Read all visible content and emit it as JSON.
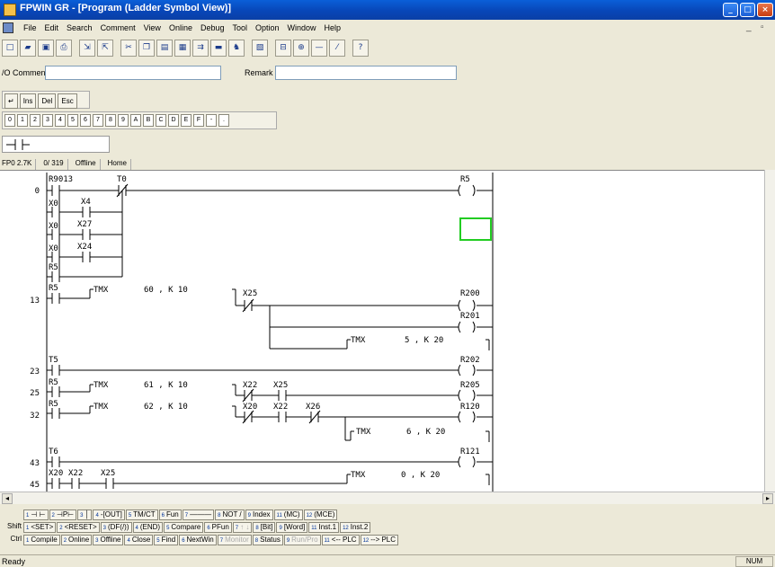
{
  "window": {
    "title": "FPWIN GR - [Program (Ladder Symbol View)]"
  },
  "menu": {
    "items": [
      "File",
      "Edit",
      "Search",
      "Comment",
      "View",
      "Online",
      "Debug",
      "Tool",
      "Option",
      "Window",
      "Help"
    ]
  },
  "io": {
    "comment_label": "/O Comment",
    "remark_label": "Remark"
  },
  "edit_buttons": [
    "↵",
    "Ins",
    "Del",
    "Esc"
  ],
  "hexkeys": [
    "0",
    "1",
    "2",
    "3",
    "4",
    "5",
    "6",
    "7",
    "8",
    "9",
    "A",
    "B",
    "C",
    "D",
    "E",
    "F",
    "-",
    "."
  ],
  "info": {
    "plc": "FP0 2.7K",
    "steps": "0/ 319",
    "mode": "Offline",
    "pos": "Home"
  },
  "ladder": {
    "r0": {
      "addr": "0",
      "c1": "R9013",
      "c2": "T0",
      "out": "R5",
      "p1": "X0",
      "p1b": "X4",
      "p2": "X0",
      "p2b": "X27",
      "p3": "X0",
      "p3b": "X24",
      "p4": "R5"
    },
    "r13": {
      "addr": "13",
      "c1": "R5",
      "fn": "TMX",
      "fn_args": "60 ,   K   10",
      "c2": "X25",
      "out1": "R200",
      "out2": "R201",
      "fn2": "TMX",
      "fn2_args": "5 ,   K   20"
    },
    "r23": {
      "addr": "23",
      "c1": "T5",
      "out": "R202"
    },
    "r25": {
      "addr": "25",
      "c1": "R5",
      "fn": "TMX",
      "fn_args": "61 ,   K   10",
      "c2": "X22",
      "c3": "X25",
      "out": "R205"
    },
    "r32": {
      "addr": "32",
      "c1": "R5",
      "fn": "TMX",
      "fn_args": "62 ,   K   10",
      "c2": "X20",
      "c3": "X22",
      "c4": "X26",
      "out": "R120",
      "fn2": "TMX",
      "fn2_args": "6 ,   K   20"
    },
    "r43": {
      "addr": "43",
      "c1": "T6",
      "out": "R121"
    },
    "r45": {
      "addr": "45",
      "c1": "X20",
      "c2": "X22",
      "c3": "X25",
      "fn": "TMX",
      "fn_args": "0 ,   K   20"
    }
  },
  "fkeys": {
    "row1": [
      [
        "1",
        "⊣ ⊢"
      ],
      [
        "2",
        "⊣P⊢"
      ],
      [
        "3",
        "│"
      ],
      [
        "4",
        "-[OUT]"
      ],
      [
        "5",
        "TM/CT"
      ],
      [
        "6",
        "Fun"
      ],
      [
        "7",
        "———"
      ],
      [
        "8",
        "NOT /"
      ],
      [
        "9",
        "Index"
      ],
      [
        "11",
        "(MC)"
      ],
      [
        "12",
        "(MCE)"
      ]
    ],
    "row2_mod": "Shift",
    "row2": [
      [
        "1",
        "<SET>"
      ],
      [
        "2",
        "<RESET>"
      ],
      [
        "3",
        "(DF(/))"
      ],
      [
        "4",
        "(END)"
      ],
      [
        "5",
        "Compare"
      ],
      [
        "6",
        "PFun"
      ],
      [
        "7",
        "↑ ↓"
      ],
      [
        "8",
        "[Bit]"
      ],
      [
        "9",
        "[Word]"
      ],
      [
        "11",
        "Inst.1"
      ],
      [
        "12",
        "Inst.2"
      ]
    ],
    "row3_mod": "Ctrl",
    "row3": [
      [
        "1",
        "Compile"
      ],
      [
        "2",
        "Online"
      ],
      [
        "3",
        "Offline"
      ],
      [
        "4",
        "Close"
      ],
      [
        "5",
        "Find"
      ],
      [
        "6",
        "NextWin"
      ],
      [
        "7",
        "Monitor"
      ],
      [
        "8",
        "Status"
      ],
      [
        "9",
        "Run/Pro"
      ],
      [
        "11",
        "<-- PLC"
      ],
      [
        "12",
        "--> PLC"
      ]
    ]
  },
  "status": {
    "message": "Ready",
    "num": "NUM"
  },
  "colors": {
    "title_bar": "#0A5FD8",
    "cursor": "#22CC22",
    "chrome": "#ECE9D8"
  }
}
